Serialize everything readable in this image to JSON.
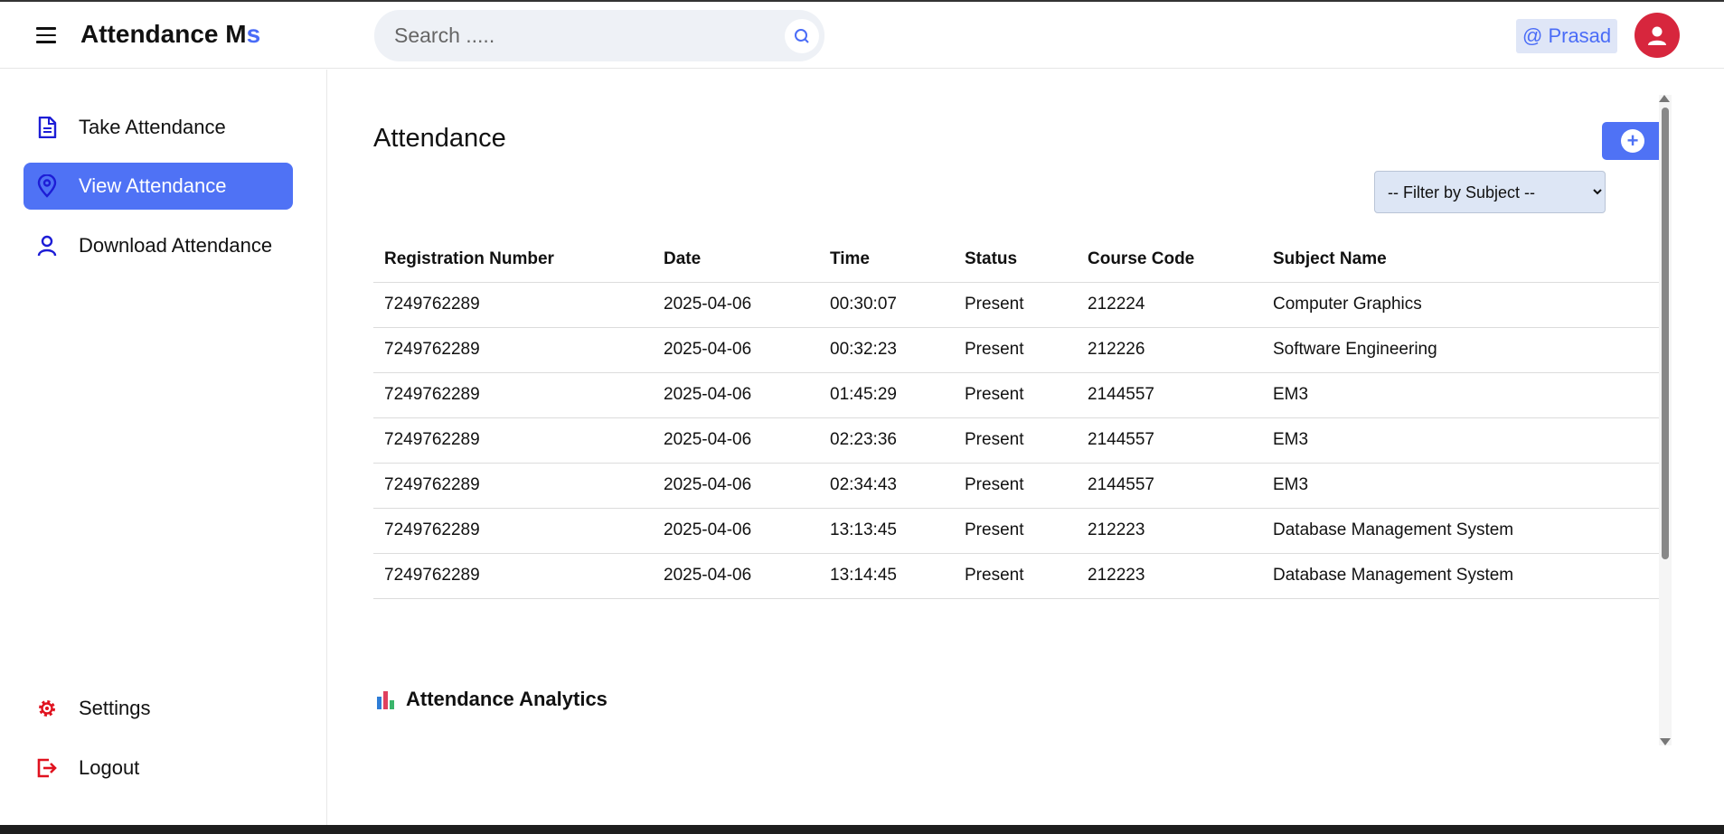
{
  "header": {
    "brand_main": "Attendance M",
    "brand_accent": "s",
    "search_placeholder": "Search .....",
    "user_tag": "@ Prasad"
  },
  "sidebar": {
    "items": [
      {
        "label": "Take Attendance",
        "icon": "document-icon"
      },
      {
        "label": "View Attendance",
        "icon": "location-pin-icon",
        "active": true
      },
      {
        "label": "Download Attendance",
        "icon": "user-icon"
      }
    ],
    "bottom_items": [
      {
        "label": "Settings",
        "icon": "gear-icon"
      },
      {
        "label": "Logout",
        "icon": "logout-icon"
      }
    ]
  },
  "main": {
    "title": "Attendance",
    "add_label": "+",
    "filter_selected": "-- Filter by Subject --",
    "table": {
      "headers": [
        "Registration Number",
        "Date",
        "Time",
        "Status",
        "Course Code",
        "Subject Name"
      ],
      "rows": [
        [
          "7249762289",
          "2025-04-06",
          "00:30:07",
          "Present",
          "212224",
          "Computer Graphics"
        ],
        [
          "7249762289",
          "2025-04-06",
          "00:32:23",
          "Present",
          "212226",
          "Software Engineering"
        ],
        [
          "7249762289",
          "2025-04-06",
          "01:45:29",
          "Present",
          "2144557",
          "EM3"
        ],
        [
          "7249762289",
          "2025-04-06",
          "02:23:36",
          "Present",
          "2144557",
          "EM3"
        ],
        [
          "7249762289",
          "2025-04-06",
          "02:34:43",
          "Present",
          "2144557",
          "EM3"
        ],
        [
          "7249762289",
          "2025-04-06",
          "13:13:45",
          "Present",
          "212223",
          "Database Management System"
        ],
        [
          "7249762289",
          "2025-04-06",
          "13:14:45",
          "Present",
          "212223",
          "Database Management System"
        ]
      ]
    },
    "analytics_title": "Attendance Analytics"
  },
  "colors": {
    "accent": "#4f72f5",
    "brand_accent": "#4a6cf7",
    "avatar": "#d7263d",
    "danger_icon": "#e0121f",
    "nav_icon": "#1d1dd6"
  }
}
